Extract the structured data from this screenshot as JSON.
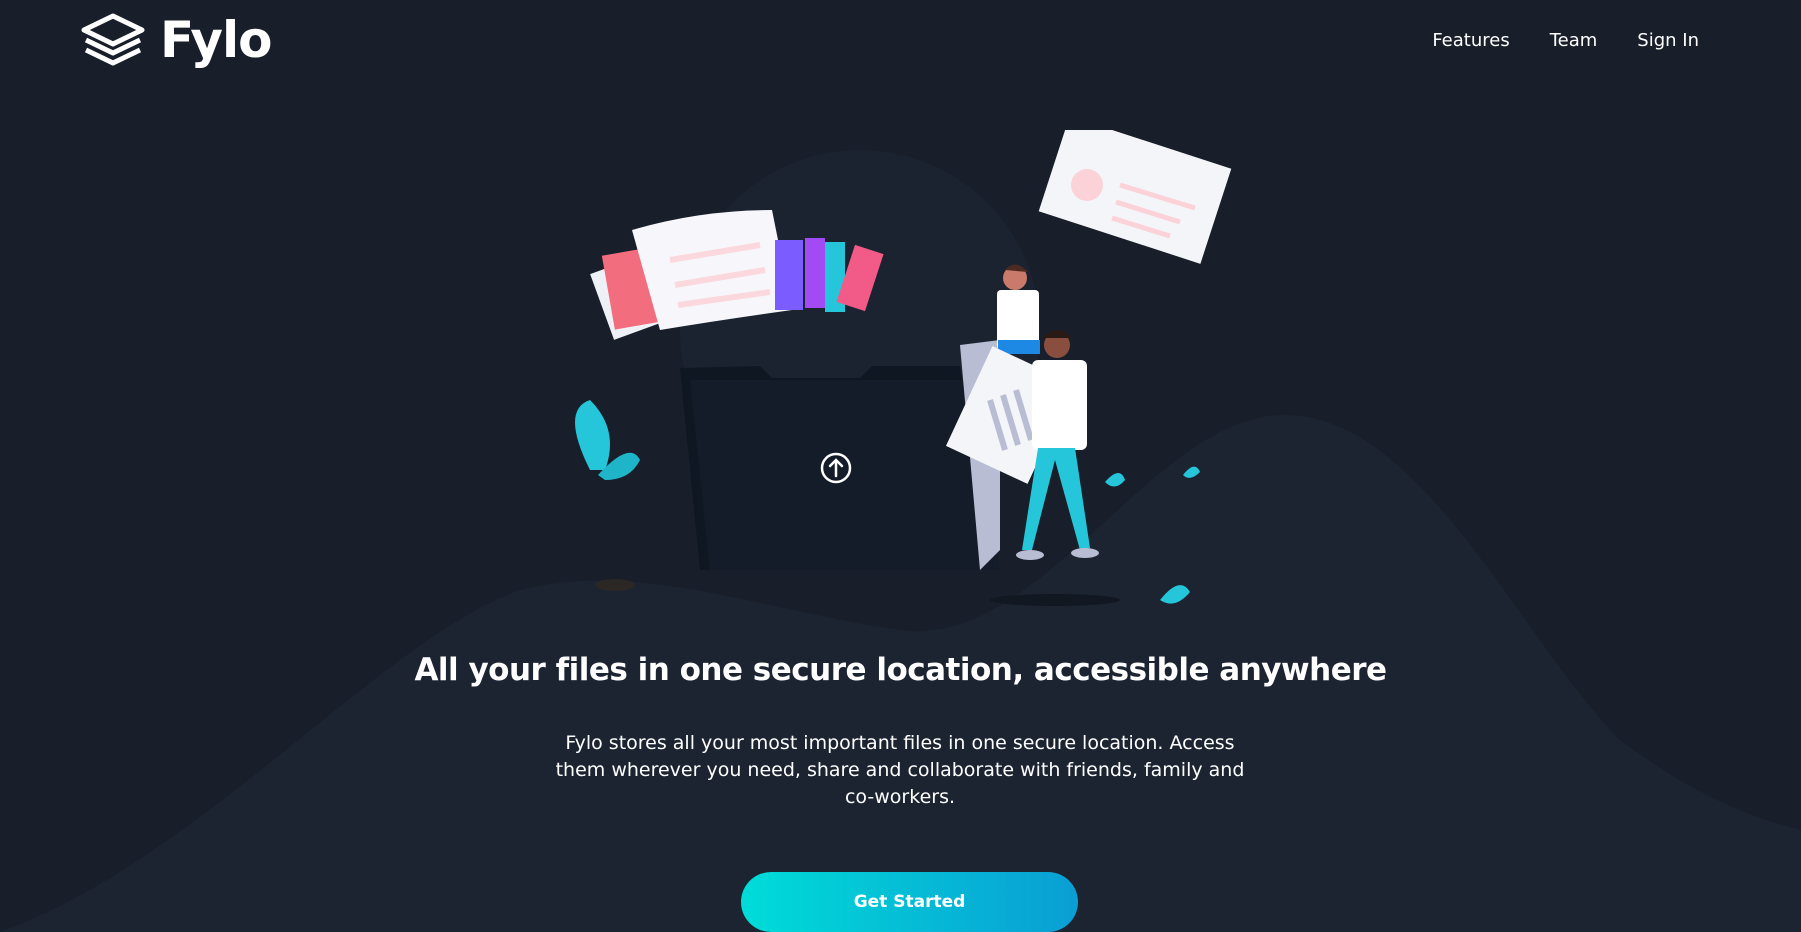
{
  "brand": {
    "name": "Fylo",
    "logo_icon": "stacked-layers-icon"
  },
  "nav": {
    "items": [
      {
        "label": "Features"
      },
      {
        "label": "Team"
      },
      {
        "label": "Sign In"
      }
    ]
  },
  "hero": {
    "illustration": "intro-illustration",
    "upload_icon": "upload-arrow-icon",
    "headline": "All your files in one secure location, accessible anywhere",
    "description": "Fylo stores all your most important files in one secure location. Access them wherever you need, share and collaborate with friends, family and co-workers.",
    "cta_label": "Get Started"
  },
  "colors": {
    "background": "#181f2a",
    "wave": "#1c2431",
    "cta_gradient_start": "#00dcd8",
    "cta_gradient_end": "#0a9ed4",
    "text": "#ffffff"
  }
}
